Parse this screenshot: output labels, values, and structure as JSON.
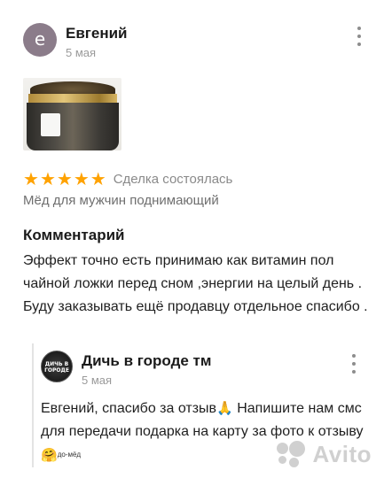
{
  "review": {
    "avatar_letter": "е",
    "author": "Евгений",
    "date": "5 мая",
    "rating": 5,
    "deal_status": "Сделка состоялась",
    "product": "Мёд для мужчин поднимающий",
    "comment_heading": "Комментарий",
    "comment_text": "Эффект точно есть принимаю как витамин пол чайной ложки перед сном ,энергии на целый день . Буду заказывать ещё продавцу отдельное спасибо ."
  },
  "reply": {
    "logo_text": "ДИЧЬ В ГОРОДЕ",
    "seller": "Дичь в городе тм",
    "date": "5 мая",
    "text_part1": "Евгений, спасибо за отзыв",
    "emoji1": "🙏",
    "text_part2": " Напишите нам смс для передачи подарка на карту за фото к отзыву",
    "emoji2": "🤗",
    "sticker_text": "до-мёд"
  },
  "watermark": {
    "text": "Avito"
  },
  "colors": {
    "star": "#ffa200",
    "muted": "#9a9a9a",
    "avatar_bg": "#8b7c8a"
  },
  "icons": {
    "star": "star-icon",
    "more": "more-vertical-icon"
  }
}
